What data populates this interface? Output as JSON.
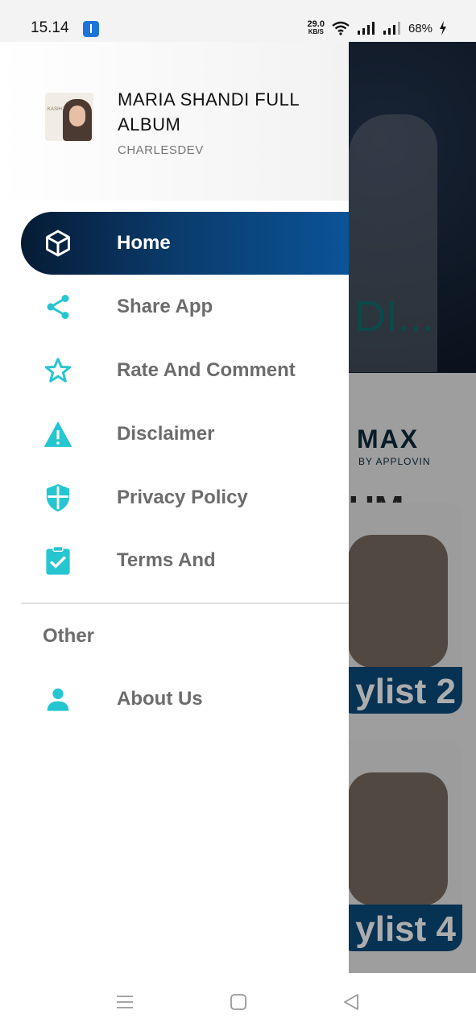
{
  "status_bar": {
    "time": "15.14",
    "net_speed_value": "29.0",
    "net_speed_unit": "KB/S",
    "battery": "68%",
    "icons": [
      "usb-debug-icon",
      "wifi-icon",
      "signal-icon",
      "signal-icon",
      "charging-icon"
    ]
  },
  "background": {
    "hero_title_fragment": "DI...",
    "ad_brand": "MAX",
    "ad_brand_sub": "BY APPLOVIN",
    "section_fragment": "UM",
    "cards": [
      {
        "label": "ylist 2"
      },
      {
        "label": "ylist 4"
      }
    ]
  },
  "drawer": {
    "header": {
      "title": "MARIA SHANDI FULL ALBUM",
      "subtitle": "CHARLESDEV",
      "thumb_text": "KASIH TUHAN"
    },
    "items": [
      {
        "label": "Home",
        "icon": "cube-icon",
        "active": true
      },
      {
        "label": "Share App",
        "icon": "share-icon"
      },
      {
        "label": "Rate And Comment",
        "icon": "star-icon"
      },
      {
        "label": "Disclaimer",
        "icon": "warning-icon"
      },
      {
        "label": "Privacy Policy",
        "icon": "shield-icon"
      },
      {
        "label": "Terms And",
        "icon": "clipboard-check-icon"
      }
    ],
    "other_section_title": "Other",
    "other_items": [
      {
        "label": "About Us",
        "icon": "person-icon"
      }
    ],
    "colors": {
      "accent": "#26c6d1",
      "active_start": "#061b35",
      "active_end": "#0a5498",
      "label": "#6c6c6c"
    }
  },
  "nav_bar": {
    "icons": [
      "menu-icon",
      "home-square-icon",
      "back-triangle-icon"
    ]
  }
}
